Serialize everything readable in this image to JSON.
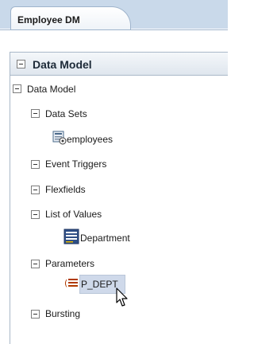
{
  "tab": {
    "label": "Employee DM"
  },
  "panel": {
    "title": "Data Model"
  },
  "tree": {
    "root": "Data Model",
    "data_sets": "Data Sets",
    "employees": "employees",
    "event_triggers": "Event Triggers",
    "flexfields": "Flexfields",
    "list_of_values": "List of Values",
    "department": "Department",
    "parameters": "Parameters",
    "p_dept": "P_DEPT",
    "bursting": "Bursting"
  },
  "colors": {
    "selection": "#cfd9ea",
    "band": "#c9d9ea",
    "border": "#a9b8c8"
  },
  "icons": [
    "collapse-box-icon",
    "dataset-icon",
    "list-of-values-icon",
    "parameter-icon",
    "mouse-pointer-icon"
  ]
}
